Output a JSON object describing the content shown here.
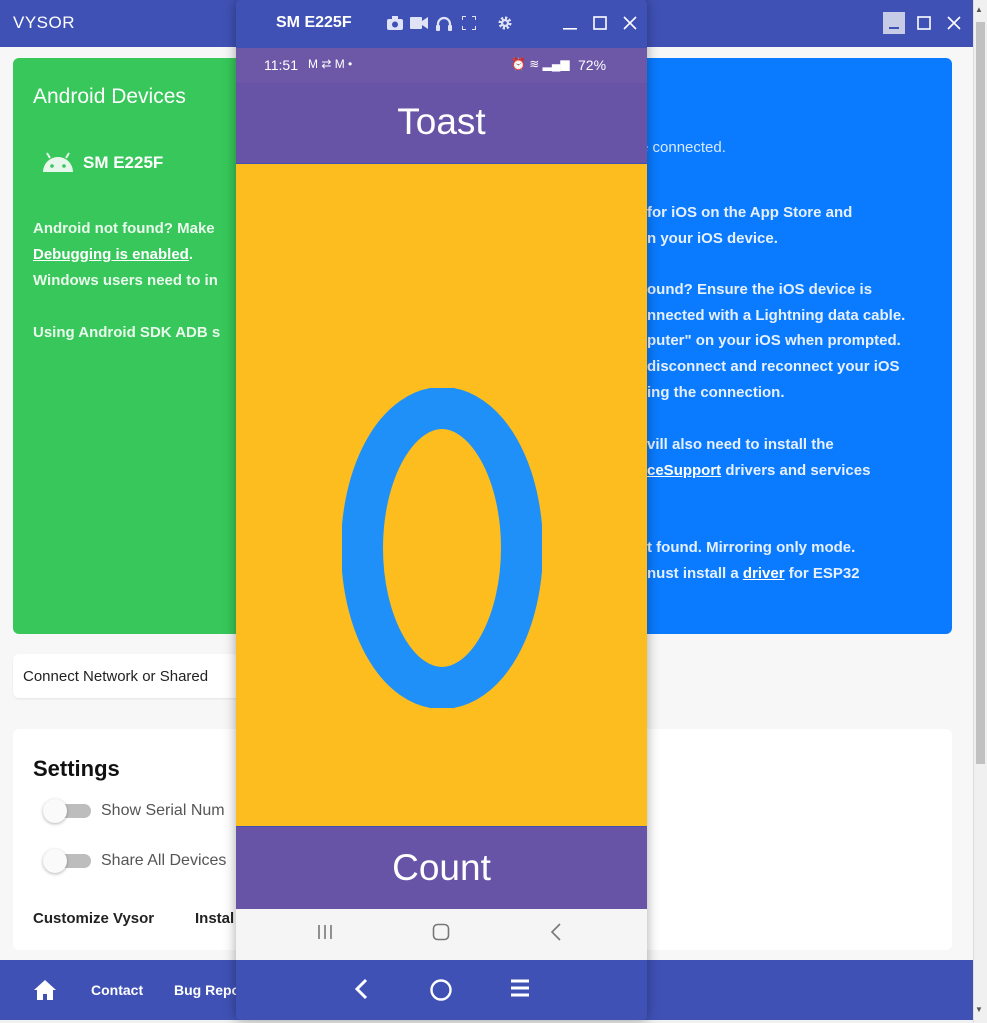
{
  "vysor": {
    "title": "VYSOR",
    "android_card": {
      "heading": "Android Devices",
      "device_name": "SM E225F",
      "line1_prefix": "Android not found? Make",
      "line2_link": "Debugging is enabled",
      "line2_suffix": ".",
      "line3": "Windows users need to in",
      "line4": "Using Android SDK ADB s"
    },
    "ios_card": {
      "connected": "e connected.",
      "line1": "for iOS on the App Store and",
      "line2": "n your iOS device.",
      "line3": "ound? Ensure the iOS device is",
      "line4": "nnected with a Lightning data cable.",
      "line5": "puter\" on your iOS when prompted.",
      "line6": "disconnect and reconnect your iOS",
      "line7": "ing the connection.",
      "line8": "vill also need to install the",
      "line9_link": "ceSupport",
      "line9_suffix": " drivers and services",
      "line10": "t found. Mirroring only mode.",
      "line11_prefix": "nust install a ",
      "line11_link": "driver",
      "line11_suffix": " for ESP32"
    },
    "connect_bar": "Connect Network or Shared",
    "settings": {
      "title": "Settings",
      "toggle1": "Show Serial Num",
      "toggle2": "Share All Devices",
      "link1": "Customize Vysor",
      "link2": "Instal"
    },
    "bottom": {
      "contact": "Contact",
      "bug": "Bug Repo"
    }
  },
  "phone": {
    "window_title": "SM E225F",
    "status": {
      "time": "11:51",
      "battery": "72%"
    },
    "app_title": "Toast",
    "counter_value": "0",
    "count_button": "Count"
  },
  "colors": {
    "vysor_blue": "#3f51b5",
    "android_green": "#37c75a",
    "ios_blue": "#0a7bff",
    "app_purple": "#6854a6",
    "app_yellow": "#fdbd1f",
    "counter_blue": "#1e90f7"
  }
}
